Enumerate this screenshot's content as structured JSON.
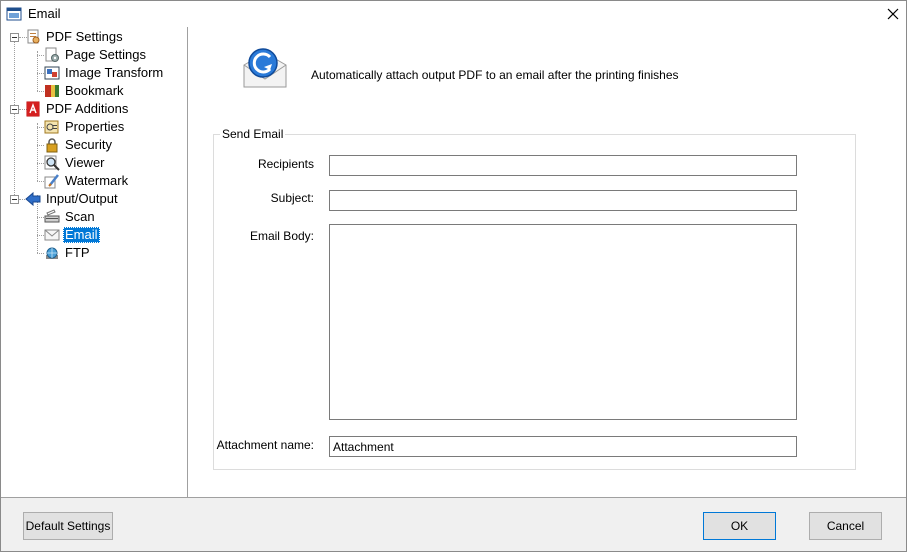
{
  "window": {
    "title": "Email"
  },
  "tree": {
    "groups": [
      {
        "label": "PDF Settings",
        "icon": "pdf-settings-icon",
        "items": [
          {
            "label": "Page Settings",
            "icon": "page-settings-icon"
          },
          {
            "label": "Image Transform",
            "icon": "image-transform-icon"
          },
          {
            "label": "Bookmark",
            "icon": "bookmark-icon"
          }
        ]
      },
      {
        "label": "PDF Additions",
        "icon": "pdf-icon",
        "items": [
          {
            "label": "Properties",
            "icon": "properties-icon"
          },
          {
            "label": "Security",
            "icon": "lock-icon"
          },
          {
            "label": "Viewer",
            "icon": "magnifier-icon"
          },
          {
            "label": "Watermark",
            "icon": "watermark-icon"
          }
        ]
      },
      {
        "label": "Input/Output",
        "icon": "arrow-left-icon",
        "items": [
          {
            "label": "Scan",
            "icon": "scanner-icon"
          },
          {
            "label": "Email",
            "icon": "envelope-icon",
            "selected": true
          },
          {
            "label": "FTP",
            "icon": "globe-icon"
          }
        ]
      }
    ]
  },
  "content": {
    "description": "Automatically attach output PDF to an email after the printing finishes",
    "group_title": "Send Email",
    "fields": {
      "recipients": {
        "label": "Recipients",
        "value": ""
      },
      "subject": {
        "label": "Subject:",
        "value": ""
      },
      "body": {
        "label": "Email Body:",
        "value": ""
      },
      "attachment": {
        "label": "Attachment name:",
        "value": "Attachment"
      }
    }
  },
  "buttons": {
    "default_settings": "Default Settings",
    "ok": "OK",
    "cancel": "Cancel"
  },
  "colors": {
    "selection": "#0078d7",
    "window_bg": "#f0f0f0"
  }
}
